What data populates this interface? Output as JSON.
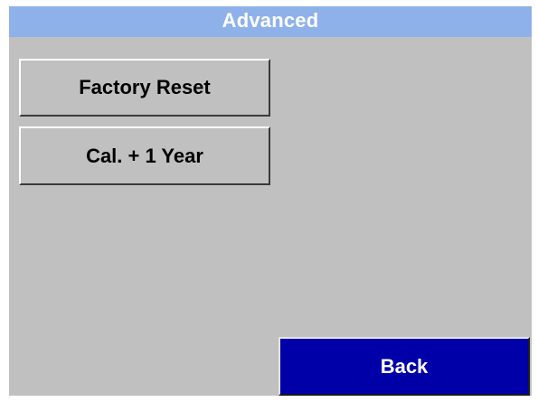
{
  "header": {
    "title": "Advanced"
  },
  "buttons": {
    "factory_reset": "Factory Reset",
    "cal_plus_one_year": "Cal. + 1 Year",
    "back": "Back"
  },
  "colors": {
    "title_bar": "#8eb1ea",
    "title_text": "#ffffff",
    "panel_background": "#c0c0c0",
    "button_face": "#c0c0c0",
    "back_button_face": "#0000a8",
    "back_button_text": "#ffffff"
  }
}
